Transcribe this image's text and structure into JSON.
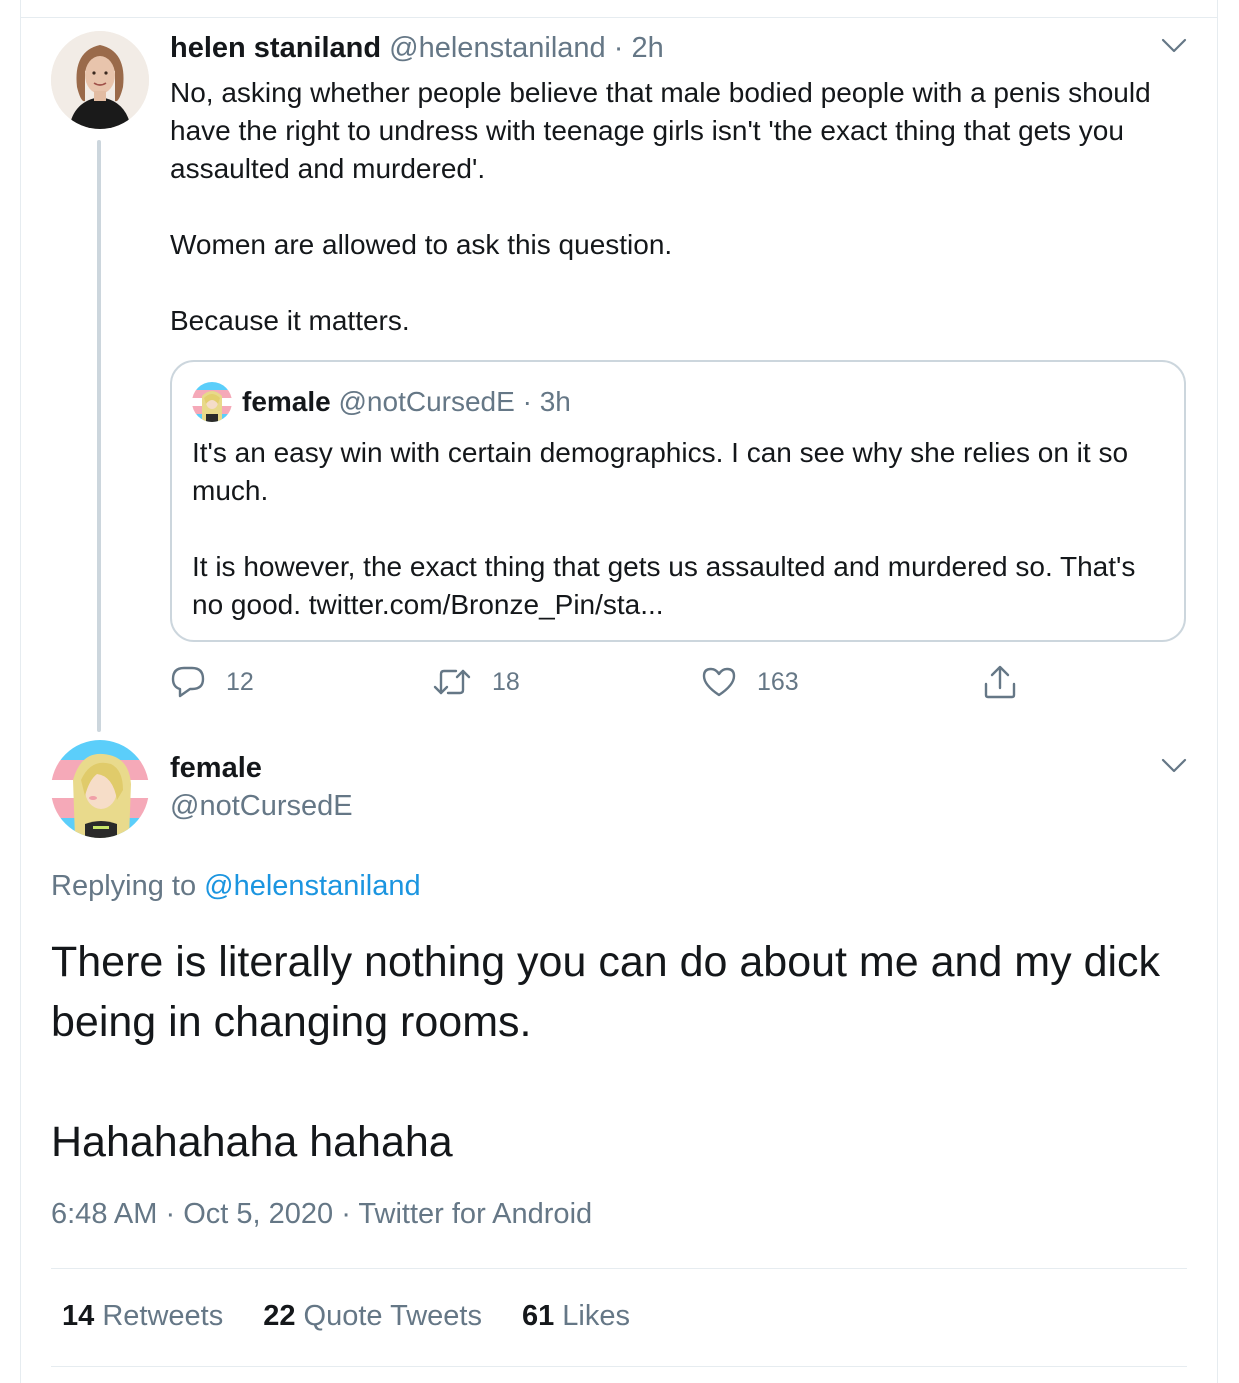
{
  "parent_tweet": {
    "name": "helen staniland",
    "handle": "@helenstaniland",
    "sep": "·",
    "time": "2h",
    "paragraphs": [
      "No, asking whether people believe that male bodied people with a penis should have the right to undress with teenage girls isn't 'the exact thing that gets you assaulted and murdered'.",
      "Women are allowed to ask this question.",
      "Because it matters."
    ],
    "quote": {
      "name": "female",
      "handle": "@notCursedE",
      "sep": "·",
      "time": "3h",
      "paragraphs": [
        "It's an easy win with certain demographics. I can see why she relies on it so much.",
        "It is however, the exact thing that gets us assaulted and murdered so. That's no good. twitter.com/Bronze_Pin/sta..."
      ]
    },
    "actions": {
      "reply_count": "12",
      "retweet_count": "18",
      "like_count": "163"
    }
  },
  "main_tweet": {
    "name": "female",
    "handle": "@notCursedE",
    "replying_prefix": "Replying to",
    "replying_handle": "@helenstaniland",
    "paragraphs": [
      "There is literally nothing you can do about me and my dick being in changing rooms.",
      "Hahahahaha hahaha"
    ],
    "time": "6:48 AM",
    "date": "Oct 5, 2020",
    "source": "Twitter for Android",
    "sep": "·",
    "stats": {
      "retweets_count": "14",
      "retweets_label": "Retweets",
      "quotes_count": "22",
      "quotes_label": "Quote Tweets",
      "likes_count": "61",
      "likes_label": "Likes"
    }
  },
  "colors": {
    "text": "#14171a",
    "muted": "#657786",
    "link": "#1b95e0",
    "border": "#e6ecf0",
    "thread_line": "#ccd6dd"
  },
  "icons": [
    "chevron-down-icon",
    "reply-icon",
    "retweet-icon",
    "like-icon",
    "share-icon"
  ]
}
